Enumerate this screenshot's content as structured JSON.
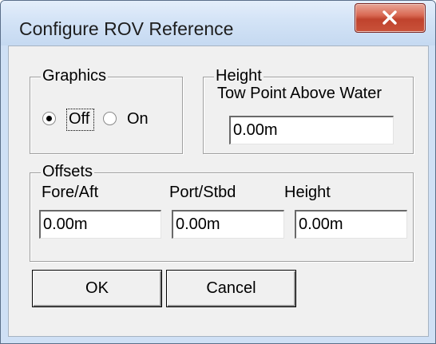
{
  "window": {
    "title": "Configure ROV Reference",
    "close_icon": "close-icon"
  },
  "graphics": {
    "legend": "Graphics",
    "options": [
      {
        "label": "Off",
        "selected": true
      },
      {
        "label": "On",
        "selected": false
      }
    ]
  },
  "height_group": {
    "legend": "Height",
    "field_label": "Tow Point Above Water",
    "value": "0.00m"
  },
  "offsets": {
    "legend": "Offsets",
    "fields": [
      {
        "label": "Fore/Aft",
        "value": "0.00m"
      },
      {
        "label": "Port/Stbd",
        "value": "0.00m"
      },
      {
        "label": "Height",
        "value": "0.00m"
      }
    ]
  },
  "buttons": {
    "ok": "OK",
    "cancel": "Cancel"
  }
}
